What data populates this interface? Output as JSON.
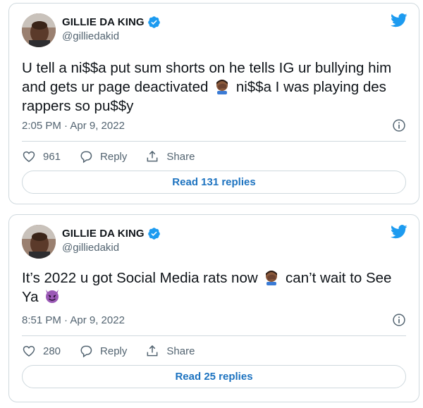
{
  "colors": {
    "twitter_blue": "#1d9bf0",
    "link_blue": "#1d73c0",
    "secondary_text": "#536471",
    "border": "#cfd9de",
    "primary_text": "#0f1419"
  },
  "icons": {
    "logo": "twitter-bird-icon",
    "verified": "verified-badge-icon",
    "info": "info-icon",
    "like": "heart-icon",
    "reply": "reply-bubble-icon",
    "share": "share-upload-icon",
    "facepalm": "facepalm-emoji",
    "devil": "smiling-devil-emoji"
  },
  "tweets": [
    {
      "author": {
        "name": "GILLIE DA KING",
        "handle": "@gilliedakid"
      },
      "text_part1": "U tell a ni$$a put sum shorts on he tells IG ur bullying him and gets ur page deactivated ",
      "text_part2": " ni$$a I was playing des rappers so pu$$y",
      "timestamp": "2:05 PM · Apr 9, 2022",
      "likes": "961",
      "reply_label": "Reply",
      "share_label": "Share",
      "read_replies_label": "Read 131 replies"
    },
    {
      "author": {
        "name": "GILLIE DA KING",
        "handle": "@gilliedakid"
      },
      "text_part1": "It’s 2022 u got Social Media rats now ",
      "text_part2": " can’t wait to See Ya ",
      "timestamp": "8:51 PM · Apr 9, 2022",
      "likes": "280",
      "reply_label": "Reply",
      "share_label": "Share",
      "read_replies_label": "Read 25 replies"
    }
  ]
}
